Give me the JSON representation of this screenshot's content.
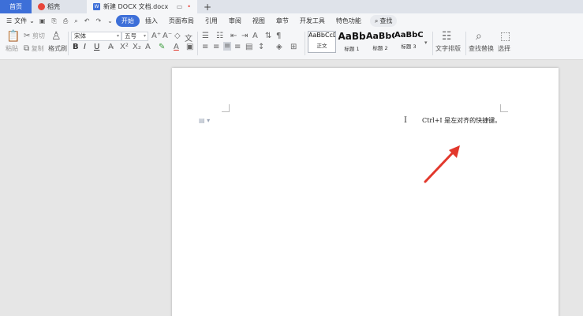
{
  "tabs": {
    "home": "首页",
    "dao": "稻壳",
    "doc": "新建 DOCX 文档.docx",
    "add": "+"
  },
  "menu": {
    "file": "文件",
    "items": [
      "开始",
      "插入",
      "页面布局",
      "引用",
      "审阅",
      "视图",
      "章节",
      "开发工具",
      "特色功能"
    ],
    "search": "查找"
  },
  "ribbon": {
    "paste": "粘贴",
    "cut": "剪切",
    "copy": "复制",
    "format_painter": "格式刷",
    "font_name": "宋体",
    "font_size": "五号",
    "styles": [
      {
        "sample": "AaBbCcDd",
        "name": "正文"
      },
      {
        "sample": "AaBb",
        "name": "标题 1"
      },
      {
        "sample": "AaBbC",
        "name": "标题 2"
      },
      {
        "sample": "AaBbC",
        "name": "标题 3"
      }
    ],
    "text_layout": "文字排版",
    "find_replace": "查找替换",
    "select": "选择"
  },
  "document": {
    "cursor": "I",
    "note": "Ctrl+I 是左对齐的快捷键。"
  },
  "colors": {
    "accent": "#3d6fd8",
    "arrow": "#e2382c",
    "highlight": "#f3d400",
    "font_color": "#e2382c"
  }
}
